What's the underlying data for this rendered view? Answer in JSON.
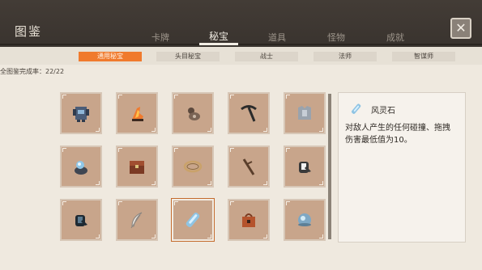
{
  "header": {
    "title": "图鉴",
    "tabs": [
      {
        "label": "卡牌"
      },
      {
        "label": "秘宝"
      },
      {
        "label": "道具"
      },
      {
        "label": "怪物"
      },
      {
        "label": "成就"
      }
    ],
    "active_tab": "秘宝",
    "close_icon": "close-icon"
  },
  "filters": [
    {
      "label": "通用秘宝",
      "active": true
    },
    {
      "label": "头目秘宝",
      "active": false
    },
    {
      "label": "战士",
      "active": false
    },
    {
      "label": "法师",
      "active": false
    },
    {
      "label": "智谋师",
      "active": false
    }
  ],
  "completion_text": "全图鉴完成率：22/22",
  "grid": {
    "items": [
      {
        "icon": "mechanical-armor-icon"
      },
      {
        "icon": "flame-boot-icon"
      },
      {
        "icon": "pouch-icon"
      },
      {
        "icon": "pickaxe-icon"
      },
      {
        "icon": "chestplate-icon"
      },
      {
        "icon": "crystal-pot-icon"
      },
      {
        "icon": "treasure-chest-icon"
      },
      {
        "icon": "rope-ring-icon"
      },
      {
        "icon": "branch-icon"
      },
      {
        "icon": "gauntlet-icon"
      },
      {
        "icon": "dark-gauntlet-icon"
      },
      {
        "icon": "feather-icon"
      },
      {
        "icon": "wind-spirit-stone-icon"
      },
      {
        "icon": "red-chest-icon"
      },
      {
        "icon": "ice-orb-icon"
      }
    ],
    "selected_index": 12
  },
  "detail": {
    "name": "风灵石",
    "icon": "wind-spirit-stone-icon",
    "description": "对敌人产生的任何碰撞、拖拽伤害最低值为10。"
  },
  "colors": {
    "accent": "#f07a2d",
    "header_bg": "#3b3530",
    "panel_bg": "#efe9df",
    "cell_bg": "#c8a58b"
  }
}
